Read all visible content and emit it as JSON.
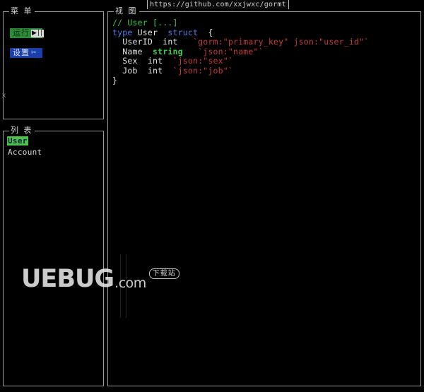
{
  "url_bar": {
    "url": "https://github.com/xxjwxc/gormt"
  },
  "menu_panel": {
    "title": "菜 单",
    "buttons": [
      {
        "label": "运行",
        "glyph": "▶||",
        "name": "run-button"
      },
      {
        "label": "设置",
        "glyph": "✂",
        "name": "settings-button"
      }
    ]
  },
  "edge_marker": {
    "glyph": "x"
  },
  "list_panel": {
    "title": "列 表",
    "items": [
      {
        "label": "User",
        "selected": true
      },
      {
        "label": "Account",
        "selected": false
      }
    ]
  },
  "view_panel": {
    "title": "视 图",
    "code_lines": [
      [
        {
          "text": "// User [...]",
          "cls": "tok-comment"
        }
      ],
      [
        {
          "text": "type",
          "cls": "tok-keyword"
        },
        {
          "text": " User  ",
          "cls": "tok-plain"
        },
        {
          "text": "struct",
          "cls": "tok-keyword"
        },
        {
          "text": "  {",
          "cls": "tok-punct"
        }
      ],
      [
        {
          "text": "  UserID  int   ",
          "cls": "tok-plain"
        },
        {
          "text": "`gorm:\"primary_key\" json:\"user_id\"`",
          "cls": "tok-tag"
        }
      ],
      [
        {
          "text": "  Name  ",
          "cls": "tok-plain"
        },
        {
          "text": "string",
          "cls": "tok-type"
        },
        {
          "text": "   ",
          "cls": "tok-plain"
        },
        {
          "text": "`json:\"name\"`",
          "cls": "tok-tag"
        }
      ],
      [
        {
          "text": "  Sex  int  ",
          "cls": "tok-plain"
        },
        {
          "text": "`json:\"sex\"`",
          "cls": "tok-tag"
        }
      ],
      [
        {
          "text": "  Job  int  ",
          "cls": "tok-plain"
        },
        {
          "text": "`json:\"job\"`",
          "cls": "tok-tag"
        }
      ],
      [
        {
          "text": "}",
          "cls": "tok-punct"
        }
      ]
    ]
  },
  "watermark": {
    "main": "UEBUG",
    "dotcom": ".com",
    "badge": "下载站"
  },
  "colors": {
    "background": "#000000",
    "border": "#9a9a9a",
    "run_button_bg": "#2e8b3a",
    "settings_button_bg": "#1b3fa8",
    "selection_bg": "#49c24a",
    "comment": "#35c945",
    "keyword": "#4f7fe8",
    "type": "#3fd04a",
    "struct_tag": "#c43b3b",
    "text": "#e4e4e4"
  }
}
